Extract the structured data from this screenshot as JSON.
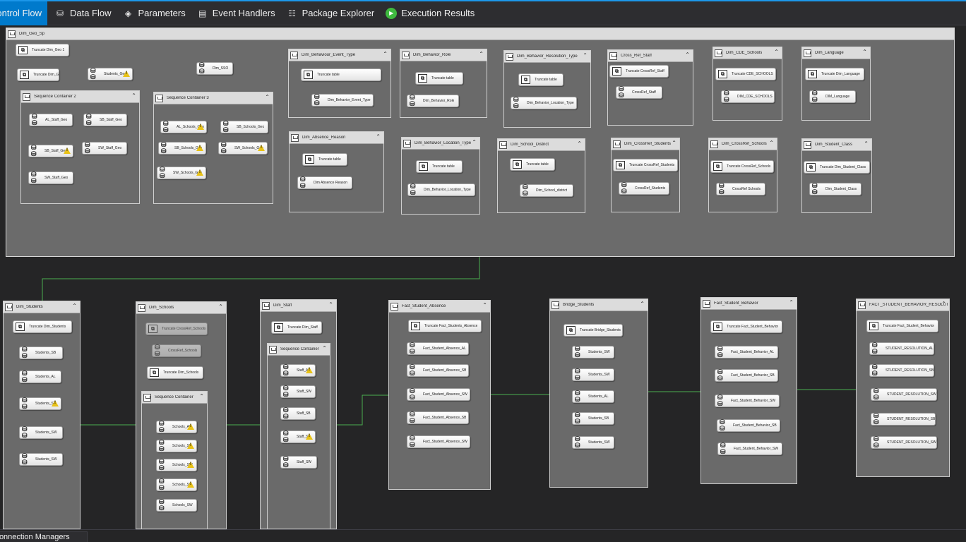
{
  "tabs": [
    {
      "label": "Control Flow",
      "icon": "control-flow-icon",
      "active": true
    },
    {
      "label": "Data Flow",
      "icon": "data-flow-icon"
    },
    {
      "label": "Parameters",
      "icon": "parameters-icon"
    },
    {
      "label": "Event Handlers",
      "icon": "event-handlers-icon"
    },
    {
      "label": "Package Explorer",
      "icon": "package-explorer-icon"
    },
    {
      "label": "Execution Results",
      "icon": "execution-results-icon"
    }
  ],
  "colors": {
    "accent": "#007acc",
    "canvas": "#252526",
    "container": "#6a6a6a",
    "connector": "#4caf50",
    "warning": "#e8c217"
  },
  "containers": {
    "dim_geo_sp": "Dim_Geo_Sp",
    "seq2": "Sequence Container 2",
    "seq3": "Sequence Container 3",
    "beh_event": "Dim_Behaviour_Event_Type",
    "beh_role": "Dim_Behavior_Role",
    "beh_res": "Dim_Behavior_Resolution_Type",
    "cross_staff": "Cross_Ref_Staff",
    "cde_schools": "Dim_CDE_Schools",
    "language": "Dim_Language",
    "absence_reason": "Dim_Absence_Reason",
    "beh_loc": "Dim_Behavior_Location_Type",
    "school_district": "Dim_School_District",
    "crossref_students": "Dim_CrossRef_Students",
    "crossref_schools": "Dim_CrossRef_Schools",
    "student_class": "Dim_Student_Class",
    "dim_students": "Dim_Students",
    "dim_schools": "Dim_Schools",
    "seq_schools": "Sequence Container",
    "dim_staff": "Dim_Staff",
    "seq_staff": "Sequence Container",
    "fact_absence": "Fact_Student_Absence",
    "bridge": "Bridge_Students",
    "fact_behavior": "Fact_Student_Behavior",
    "fact_resolution": "FACT_STUDENT_BEHAVIOR_RESOLUTION"
  },
  "tasks": {
    "t1": "Truncate Dim_Geo 1",
    "t2": "Truncate Dim_Geo",
    "t3": "Students_Geo",
    "t4": "Dim_SSO",
    "s2a": "AL_Staff_Geo",
    "s2b": "SB_Staff_Geo",
    "s2c": "SB_Staff_Geo",
    "s2d": "SW_Staff_Geo",
    "s2e": "SW_Staff_Geo",
    "s3a": "AL_Schools_Geo",
    "s3b": "SB_Schools_Geo",
    "s3c": "SB_Schools_Geo",
    "s3d": "SW_Schools_Geo",
    "s3e": "SW_Schools_Geo",
    "be1": "Truncate table",
    "be2": "Dim_Behavior_Event_Type",
    "br1": "Truncate table",
    "br2": "Dim_Behavior_Role",
    "bres1": "Truncate table",
    "bres2": "Dim_Behavior_Location_Type",
    "cs1": "Truncate CrossRef_Staff",
    "cs2": "CrossRef_Staff",
    "cde1": "Truncate CDE_SCHOOLS",
    "cde2": "DIM_CDE_SCHOOLS",
    "lg1": "Truncate Dim_Language",
    "lg2": "DIM_Language",
    "ar1": "Truncate table",
    "ar2": "Dim Absence Reason",
    "bl1": "Truncate table",
    "bl2": "Dim_Behavior_Location_Type",
    "sd1": "Truncate table",
    "sd2": "Dim_School_district",
    "crs1": "Truncate CrossRef_Students",
    "crs2": "CrossRef_Students",
    "crsc1": "Truncate CrossRef_Schools",
    "crsc2": "CrossRef Schools",
    "sc1": "Truncate Dim_Student_Class",
    "sc2": "Dim_Student_Class",
    "ds1": "Truncate Dim_Students",
    "ds2": "Students_SB",
    "ds3": "Students_AL",
    "ds4": "Students_SB",
    "ds5": "Students_SW",
    "ds6": "Students_SW",
    "dsc1": "Truncate CrossRef_Schools",
    "dsc2": "CrossRef_Schools",
    "dsc3": "Truncate Dim_Schools",
    "ssa": "Schools_AL",
    "ssb": "Schools_SB",
    "ssc": "Schools_SW",
    "ssd": "Schools_SB",
    "sse": "Schools_SW",
    "dst1": "Truncate Dim_Staff",
    "sta": "Staff_AL",
    "stb": "Staff_SW",
    "stc": "Staff_SB",
    "std": "Staff_SB",
    "ste": "Staff_SW",
    "fa1": "Truncate Fact_Students_Absence",
    "fa2": "Fact_Student_Absence_AL",
    "fa3": "Fact_Student_Absence_SB",
    "fa4": "Fact_Student_Absence_SW",
    "fa5": "Fact_Student_Absence_SB",
    "fa6": "Fact_Student_Absence_SW",
    "bs1": "Truncate Bridge_Students",
    "bs2": "Students_SW",
    "bs3": "Students_SW",
    "bs4": "Students_AL",
    "bs5": "Students_SB",
    "bs6": "Students_SW",
    "fb1": "Truncate Fact_Student_Behavior",
    "fb2": "Fact_Student_Behavior_AL",
    "fb3": "Fact_Student_Behavior_SB",
    "fb4": "Fact_Student_Behavior_SW",
    "fb5": "Fact_Student_Behavior_SB",
    "fb6": "Fact_Student_Behavior_SW",
    "fr1": "Truncate Fact_Student_Behavior",
    "fr2": "STUDENT_RESOLUTION_AL",
    "fr3": "STUDENT_RESOLUTION_SB",
    "fr4": "STUDENT_RESOLUTION_SW",
    "fr5": "STUDENT_RESOLUTION_SB",
    "fr6": "STUDENT_RESOLUTION_SW"
  },
  "bottom": {
    "connection_managers": "Connection Managers"
  }
}
